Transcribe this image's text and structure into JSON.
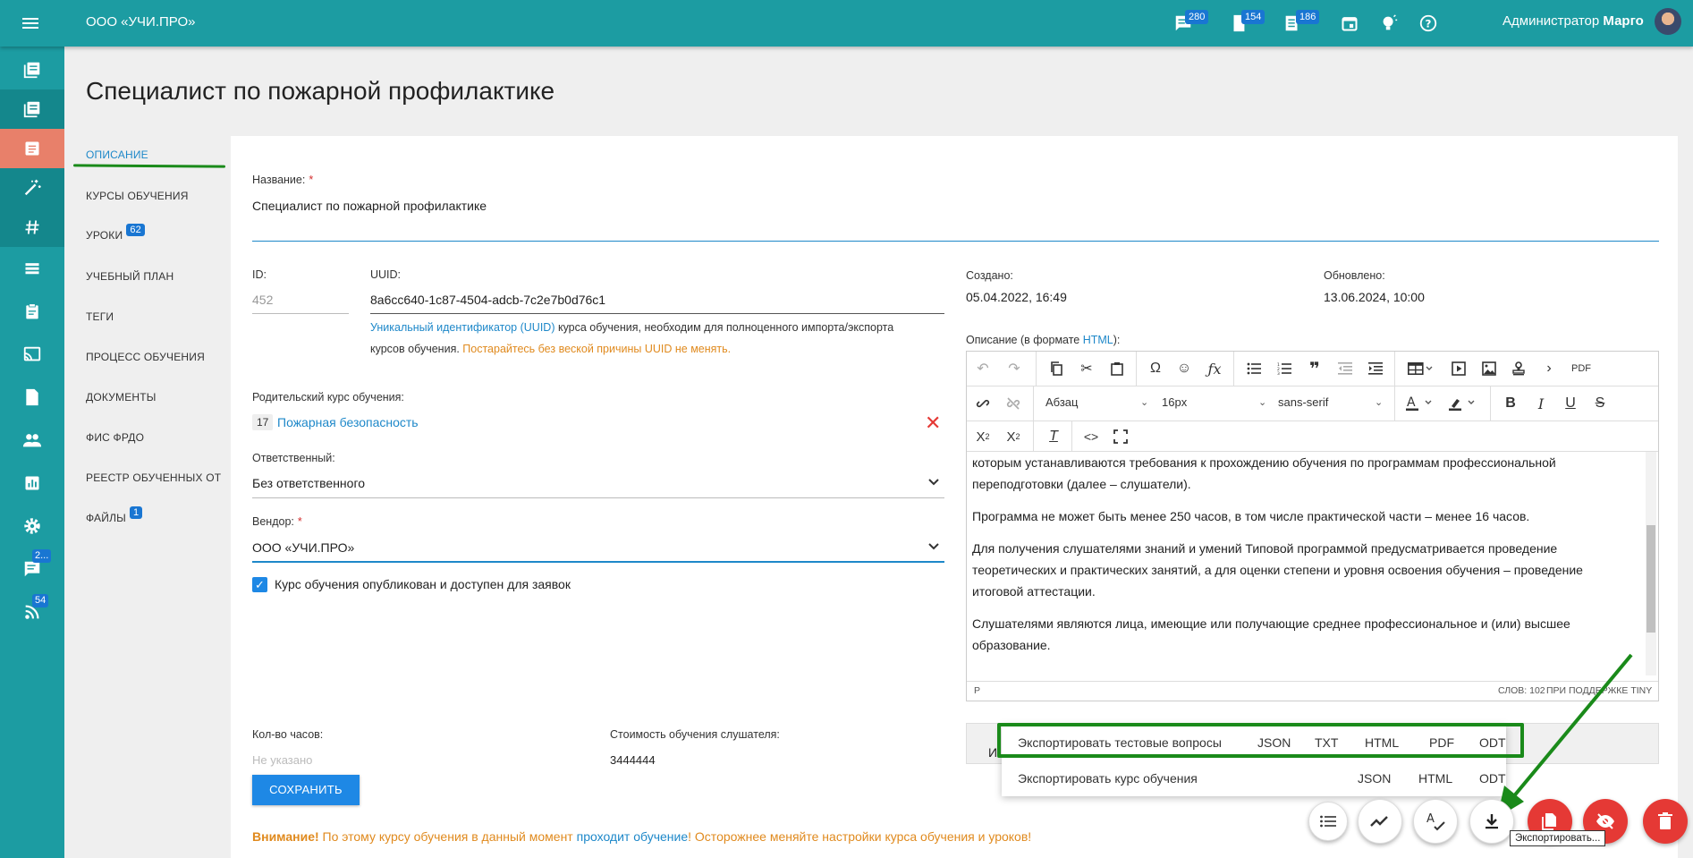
{
  "topbar": {
    "brand": "ООО «УЧИ.ПРО»",
    "badge_1": "280",
    "badge_2": "154",
    "badge_3": "186",
    "user_role": "Администратор",
    "user_name": "Марго"
  },
  "sidebar": {
    "badge_chat": "2...",
    "badge_feed": "54"
  },
  "page": {
    "title": "Специалист по пожарной профилактике"
  },
  "leftnav": {
    "items": [
      {
        "label": "ОПИСАНИЕ"
      },
      {
        "label": "КУРСЫ ОБУЧЕНИЯ"
      },
      {
        "label": "УРОКИ",
        "count": "62"
      },
      {
        "label": "УЧЕБНЫЙ ПЛАН"
      },
      {
        "label": "ТЕГИ"
      },
      {
        "label": "ПРОЦЕСС ОБУЧЕНИЯ"
      },
      {
        "label": "ДОКУМЕНТЫ"
      },
      {
        "label": "ФИС ФРДО"
      },
      {
        "label": "РЕЕСТР ОБУЧЕННЫХ ОТ"
      },
      {
        "label": "ФАЙЛЫ",
        "count": "1"
      }
    ]
  },
  "form": {
    "name_label": "Название:",
    "name_value": "Специалист по пожарной профилактике",
    "id_label": "ID:",
    "id_value": "452",
    "uuid_label": "UUID:",
    "uuid_value": "8a6cc640-1c87-4504-adcb-7c2e7b0d76c1",
    "uuid_hint_link": "Уникальный идентификатор (UUID)",
    "uuid_hint_text": " курса обучения, необходим для полноценного импорта/экспорта",
    "uuid_hint_text2": "курсов обучения. ",
    "uuid_hint_warn": "Постарайтесь без веской причины UUID не менять.",
    "created_label": "Создано:",
    "created_value": "05.04.2022, 16:49",
    "updated_label": "Обновлено:",
    "updated_value": "13.06.2024, 10:00",
    "parent_label": "Родительский курс обучения:",
    "parent_id": "17",
    "parent_name": "Пожарная безопасность",
    "owner_label": "Ответственный:",
    "owner_value": "Без ответственного",
    "vendor_label": "Вендор:",
    "vendor_value": "ООО «УЧИ.ПРО»",
    "published_label": "Курс обучения опубликован и доступен для заявок",
    "hours_label": "Кол-во часов:",
    "hours_placeholder": "Не указано",
    "price_label": "Стоимость обучения слушателя:",
    "price_value": "3444444",
    "save_label": "СОХРАНИТЬ",
    "desc_label_pre": "Описание (в формате ",
    "desc_label_link": "HTML",
    "desc_label_post": "):"
  },
  "editor": {
    "block_format": "Абзац",
    "font_size": "16px",
    "font_family": "sans-serif",
    "pdf_label": "PDF",
    "paragraphs": [
      "которым устанавливаются требования к прохождению обучения по программам профессиональной переподготовки (далее – слушатели).",
      "Программа не может быть менее 250 часов, в том числе практической части – менее 16 часов.",
      "Для получения слушателями знаний и умений Типовой программой предусматривается проведение теоретических и практических занятий, а для оценки степени и уровня освоения обучения – проведение итоговой аттестации.",
      "Слушателями являются лица, имеющие или получающие среднее профессиональное и (или) высшее образование."
    ],
    "status_path": "P",
    "word_count": "СЛОВ: 102",
    "powered": "ПРИ ПОДДЕРЖКЕ TINY"
  },
  "export_menu": {
    "row1_label": "Экспортировать тестовые вопросы",
    "row1_json": "JSON",
    "row1_txt": "TXT",
    "row1_html": "HTML",
    "row1_pdf": "PDF",
    "row1_odt": "ODT",
    "row2_label": "Экспортировать курс обучения",
    "row2_json": "JSON",
    "row2_html": "HTML",
    "row2_odt": "ODT"
  },
  "tooltip": "Экспортировать...",
  "gray_bar_text": "И",
  "warning": {
    "bold": "Внимание!",
    "text1": " По этому курсу обучения в данный момент ",
    "link": "проходит обучение",
    "text2": "! Осторожнее меняйте настройки курса обучения и уроков!"
  },
  "colors": {
    "teal": "#1c9ca2",
    "accent_orange": "#e8806a",
    "blue": "#1e88e5",
    "red": "#e53935",
    "annotation_green": "#1a8a1a"
  }
}
